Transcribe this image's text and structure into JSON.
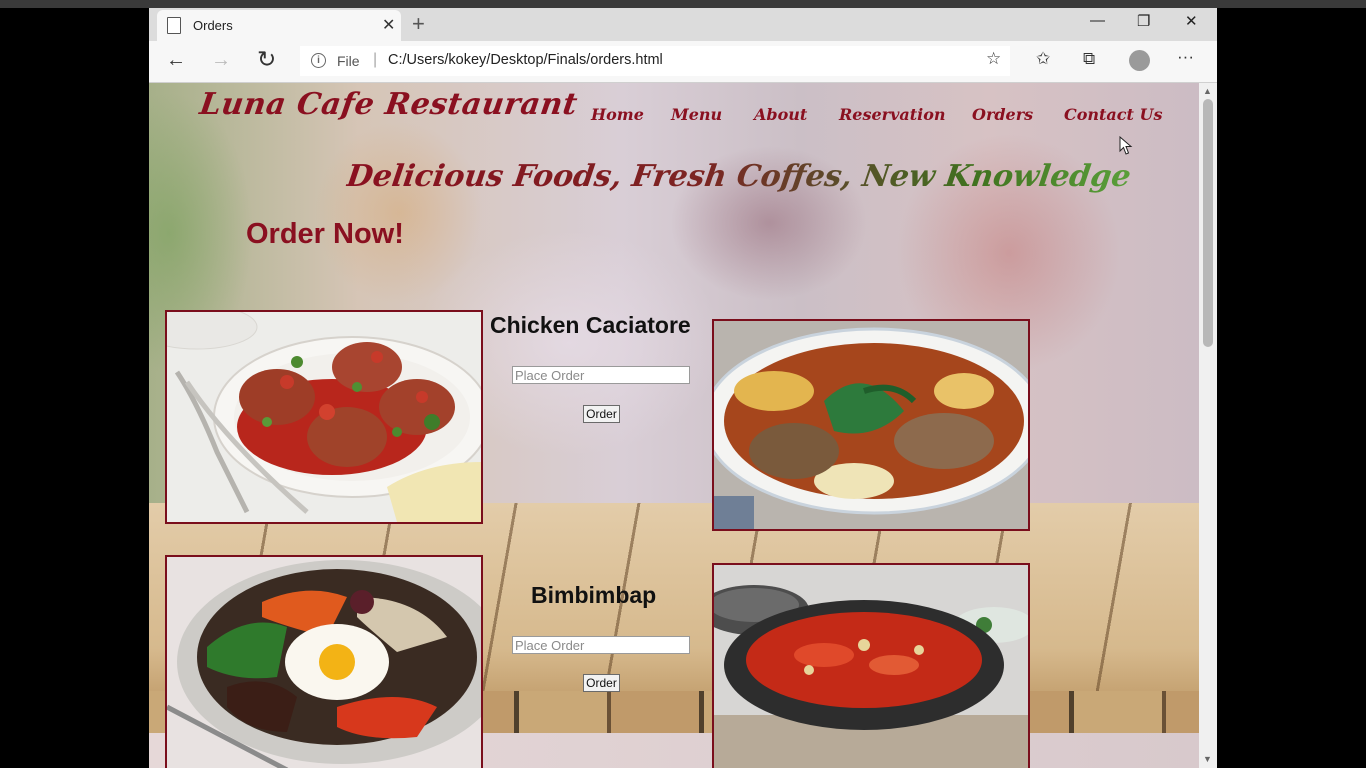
{
  "browser": {
    "tab_title": "Orders",
    "tab_close": "✕",
    "new_tab": "+",
    "minimize": "—",
    "maximize": "❐",
    "close": "✕",
    "back": "←",
    "forward": "→",
    "refresh": "↻",
    "info_glyph": "i",
    "file_label": "File",
    "separator": "|",
    "url": "C:/Users/kokey/Desktop/Finals/orders.html",
    "favorite": "☆",
    "favorites_bar": "✩",
    "collections": "⧉",
    "more": "···"
  },
  "site": {
    "brand": "Luna Cafe Restaurant",
    "nav": [
      "Home",
      "Menu",
      "About",
      "Reservation",
      "Orders",
      "Contact Us"
    ],
    "tagline": "Delicious Foods, Fresh Coffes, New Knowledge",
    "order_heading": "Order Now!"
  },
  "dishes": [
    {
      "name": "Chicken Caciatore",
      "placeholder": "Place Order",
      "button": "Order"
    },
    {
      "name": "Bimbimbap",
      "placeholder": "Place Order",
      "button": "Order"
    }
  ],
  "scrollbar": {
    "up": "▲",
    "down": "▼"
  },
  "colors": {
    "brand": "#8a1020",
    "tagline_end": "#5a9f3a",
    "frame": "#7a0e1c"
  }
}
